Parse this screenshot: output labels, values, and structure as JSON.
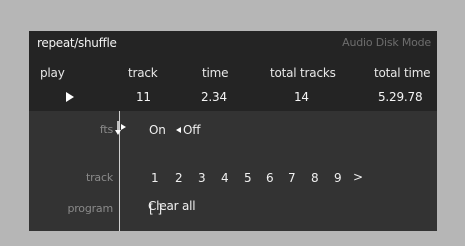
{
  "header": {
    "title": "repeat/shuffle",
    "mode": "Audio Disk Mode",
    "columns": [
      "play",
      "track",
      "time",
      "total tracks",
      "total time"
    ],
    "values": {
      "track": "11",
      "time": "2.34",
      "total_tracks": "14",
      "total_time": "5.29.78"
    },
    "play_icon": "play-icon"
  },
  "rows": {
    "fts_label": "fts",
    "fts_on": "On",
    "fts_off": "Off",
    "track_label": "track",
    "tracks": [
      "1",
      "2",
      "3",
      "4",
      "5",
      "6",
      "7",
      "8",
      "9"
    ],
    "tracks_more": ">",
    "program_label": "program",
    "program_value": "[ ]",
    "clear_all": "Clear all"
  }
}
